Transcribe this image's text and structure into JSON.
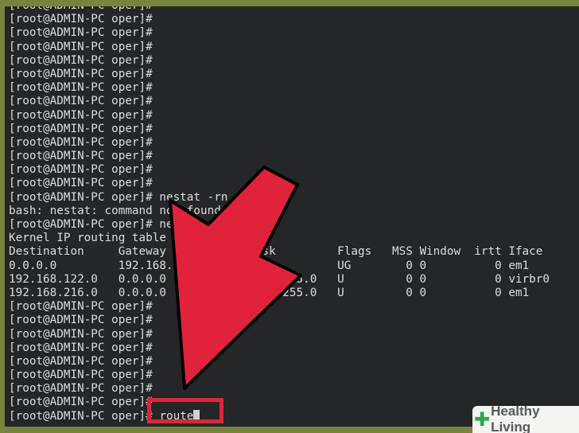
{
  "terminal": {
    "lines": [
      "[root@ADMIN-PC oper]#",
      "[root@ADMIN-PC oper]#",
      "[root@ADMIN-PC oper]#",
      "[root@ADMIN-PC oper]#",
      "[root@ADMIN-PC oper]#",
      "[root@ADMIN-PC oper]#",
      "[root@ADMIN-PC oper]#",
      "[root@ADMIN-PC oper]#",
      "[root@ADMIN-PC oper]#",
      "[root@ADMIN-PC oper]#",
      "[root@ADMIN-PC oper]#",
      "[root@ADMIN-PC oper]#",
      "[root@ADMIN-PC oper]#",
      "[root@ADMIN-PC oper]#",
      "[root@ADMIN-PC oper]# nestat -rn",
      "bash: nestat: command not found",
      "[root@ADMIN-PC oper]# netstat -rn",
      "Kernel IP routing table",
      "Destination     Gateway         Genmask         Flags   MSS Window  irtt Iface",
      "0.0.0.0         192.168.216.2   0.0.0.0         UG        0 0          0 em1",
      "192.168.122.0   0.0.0.0         255.255.255.0   U         0 0          0 virbr0",
      "192.168.216.0   0.0.0.0         255.255.255.0   U         0 0          0 em1",
      "[root@ADMIN-PC oper]#",
      "[root@ADMIN-PC oper]#",
      "[root@ADMIN-PC oper]#",
      "[root@ADMIN-PC oper]#",
      "[root@ADMIN-PC oper]#",
      "[root@ADMIN-PC oper]#",
      "[root@ADMIN-PC oper]#",
      "[root@ADMIN-PC oper]#"
    ],
    "prompt": "[root@ADMIN-PC oper]# ",
    "current_command": "route"
  },
  "annotation": {
    "arrow_color": "#e0233a",
    "highlight_color": "#e0233a"
  },
  "watermark": {
    "brand": "Healthy Living",
    "brand_color": "#555a5e",
    "cross_color": "#2ea44f"
  }
}
